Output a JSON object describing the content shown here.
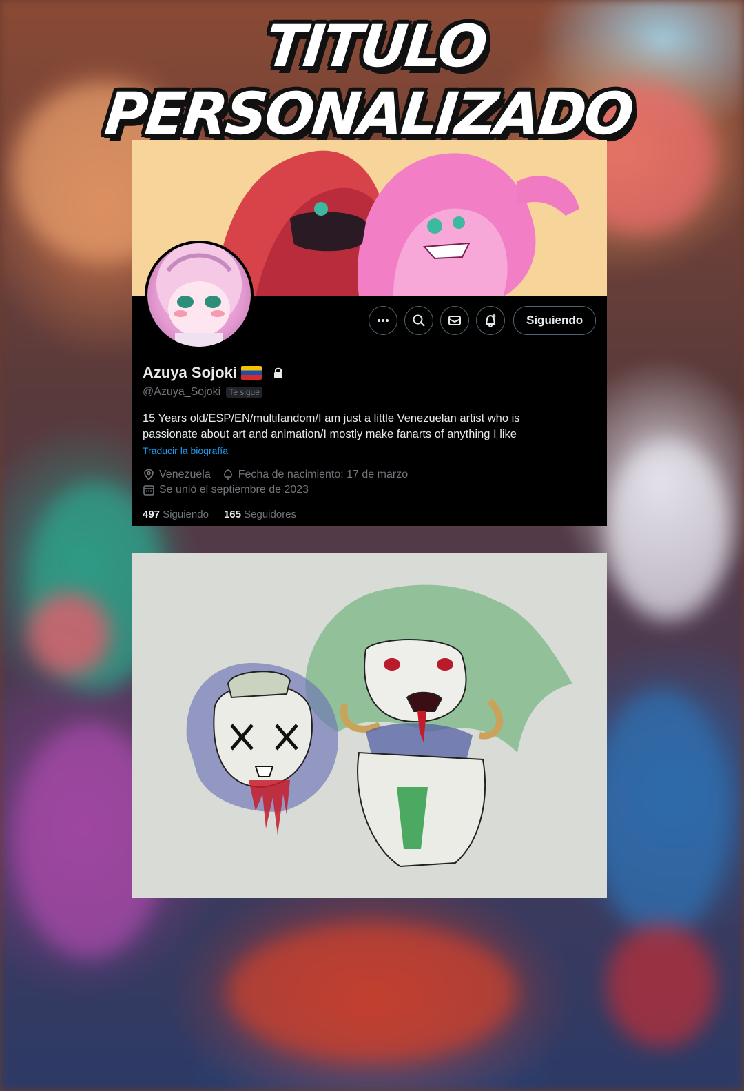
{
  "title": "TITULO PERSONALIZADO",
  "profile": {
    "display_name": "Azuya Sojoki",
    "flag": "venezuela-flag-icon",
    "lock_icon": "lock-icon",
    "handle": "@Azuya_Sojoki",
    "follows_you": "Te sigue",
    "bio_line1": "15 Years old/ESP/EN/multifandom/I am just a little Venezuelan artist who is",
    "bio_line2": "passionate about art and animation/I mostly make fanarts of anything I like",
    "translate_bio": "Traducir la biografía",
    "location": "Venezuela",
    "birthday": "Fecha de nacimiento: 17 de marzo",
    "joined": "Se unió el septiembre de 2023",
    "following_count": "497",
    "following_label": "Siguiendo",
    "followers_count": "165",
    "followers_label": "Seguidores"
  },
  "actions": {
    "more_icon": "more-icon",
    "search_icon": "search-icon",
    "message_icon": "message-icon",
    "notify_icon": "bell-plus-icon",
    "follow_label": "Siguiendo"
  },
  "colors": {
    "accent": "#1d9bf0",
    "card_bg": "#000000",
    "muted_text": "#71767b",
    "primary_text": "#e7e9ea"
  }
}
